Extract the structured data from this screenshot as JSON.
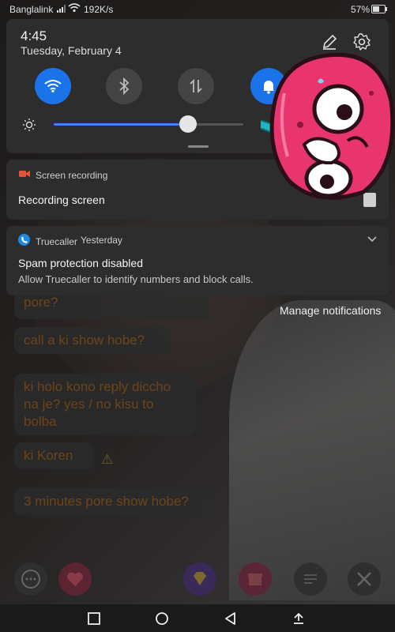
{
  "status_bar": {
    "carrier": "Banglalink",
    "speed": "192K/s",
    "battery": "57%"
  },
  "quick_settings": {
    "time": "4:45",
    "date": "Tuesday, February 4",
    "brightness": 0.71,
    "tiles": [
      {
        "name": "wifi",
        "state": "on"
      },
      {
        "name": "bluetooth",
        "state": "off"
      },
      {
        "name": "mobile-data",
        "state": "off"
      },
      {
        "name": "notifications",
        "state": "on"
      }
    ]
  },
  "notifications": [
    {
      "app": "Screen recording",
      "title": "Recording screen"
    },
    {
      "app": "Truecaller",
      "time": "Yesterday",
      "title": "Spam protection disabled",
      "text": "Allow Truecaller to identify numbers and block calls."
    }
  ],
  "manage_label": "Manage notifications",
  "chat": {
    "bubbles": [
      "pore?",
      "call a ki show hobe?",
      "ki holo kono reply diccho na je? yes / no kisu to bolba",
      "ki Koren",
      "3 minutes pore show hobe?"
    ]
  },
  "colors": {
    "accent": "#1a73e8",
    "panel": "#2d2d2d",
    "bubble_text": "#7a4a17",
    "sticker_pink": "#e8356f",
    "arrow_teal": "#1fb5c4"
  },
  "icons": [
    "edit-icon",
    "settings-icon",
    "wifi-icon",
    "bluetooth-icon",
    "data-arrows-icon",
    "bell-icon",
    "brightness-icon",
    "screen-record-icon",
    "truecaller-icon",
    "chevron-down-icon"
  ]
}
